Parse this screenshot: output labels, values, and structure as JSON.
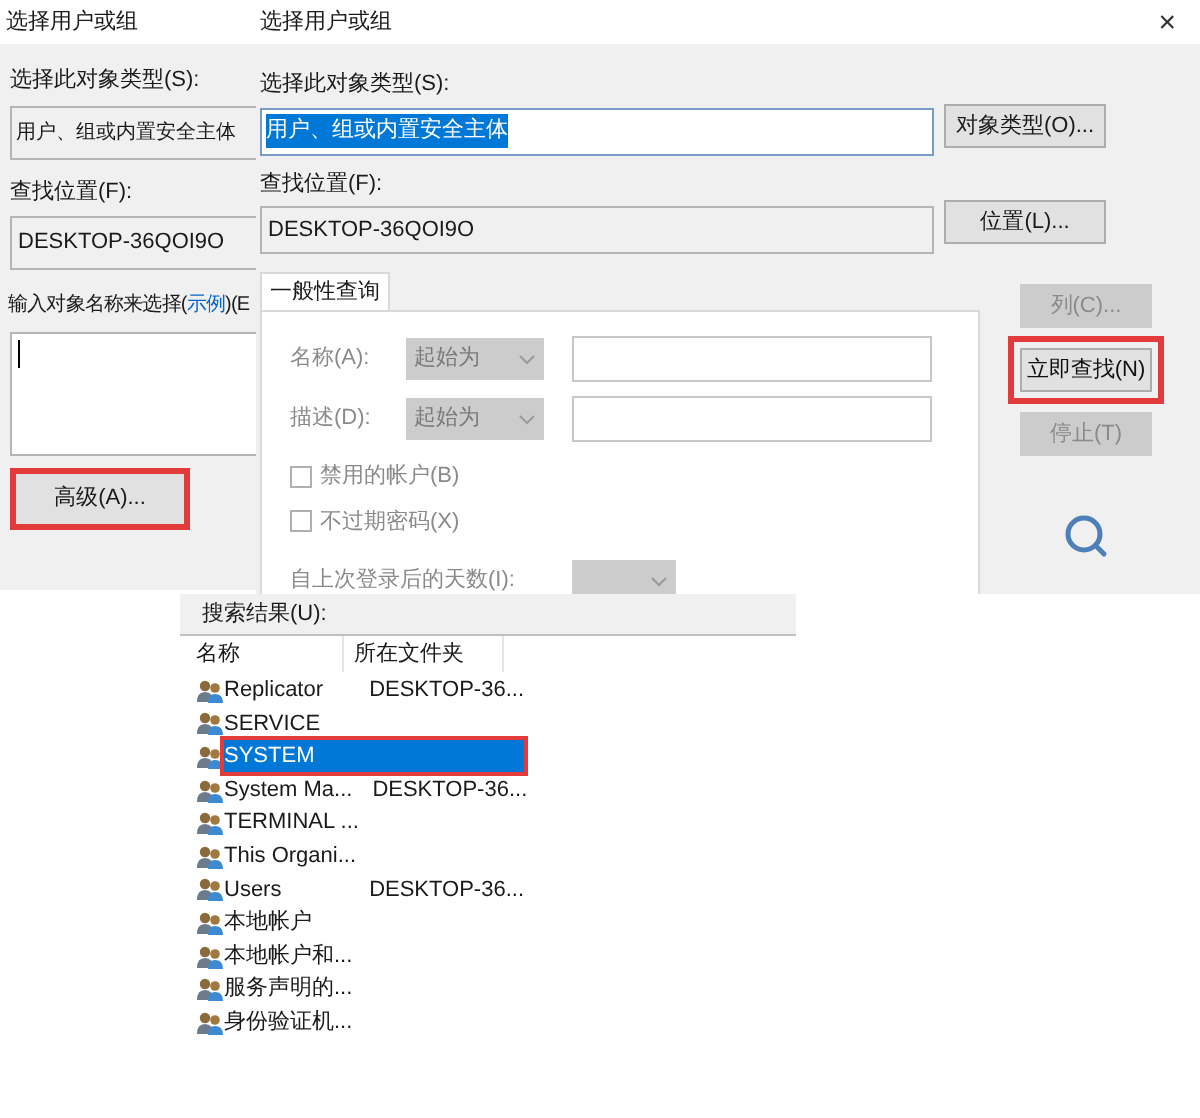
{
  "back_dialog": {
    "title": "选择用户或组",
    "object_type_label": "选择此对象类型(S):",
    "object_type_value": "用户、组或内置安全主体",
    "location_label": "查找位置(F):",
    "location_value": "DESKTOP-36QOI9O",
    "names_label_start": "输入对象名称来选择(",
    "names_label_link": "示例",
    "names_label_end": ")(E",
    "advanced_button": {
      "label": "高级(A)...",
      "highlighted": true
    }
  },
  "dialog": {
    "title": "选择用户或组",
    "close": "×",
    "object_type_label": "选择此对象类型(S):",
    "object_type_value": {
      "text": "用户、组或内置安全主体",
      "selected": true
    },
    "object_types_button": "对象类型(O)...",
    "location_label": "查找位置(F):",
    "location_value": "DESKTOP-36QOI9O",
    "locations_button": "位置(L)...",
    "tabs": [
      {
        "label": "一般性查询",
        "selected": true
      }
    ],
    "query": {
      "name_label": "名称(A):",
      "name_mode": "起始为",
      "description_label": "描述(D):",
      "description_mode": "起始为",
      "checkboxes": [
        {
          "label": "禁用的帐户(B)",
          "checked": false
        },
        {
          "label": "不过期密码(X)",
          "checked": false
        }
      ],
      "days_label": "自上次登录后的天数(I):"
    },
    "side_buttons": [
      {
        "label": "列(C)...",
        "disabled": true,
        "highlighted": false
      },
      {
        "label": "立即查找(N)",
        "disabled": false,
        "highlighted": true
      },
      {
        "label": "停止(T)",
        "disabled": true,
        "highlighted": false
      }
    ]
  },
  "results": {
    "label": "搜索结果(U):",
    "columns": [
      "名称",
      "所在文件夹"
    ],
    "rows": [
      {
        "name": "Replicator",
        "folder": "DESKTOP-36...",
        "selected": false,
        "highlighted": false
      },
      {
        "name": "SERVICE",
        "selected": false,
        "highlighted": false
      },
      {
        "name": "SYSTEM",
        "selected": true,
        "highlighted": true
      },
      {
        "name": "System Ma...",
        "folder": "DESKTOP-36...",
        "selected": false,
        "highlighted": false
      },
      {
        "name": "TERMINAL ...",
        "selected": false,
        "highlighted": false
      },
      {
        "name": "This Organi...",
        "selected": false,
        "highlighted": false
      },
      {
        "name": "Users",
        "folder": "DESKTOP-36...",
        "selected": false,
        "highlighted": false
      },
      {
        "name": "本地帐户",
        "selected": false,
        "highlighted": false
      },
      {
        "name": "本地帐户和...",
        "selected": false,
        "highlighted": false
      },
      {
        "name": "服务声明的...",
        "selected": false,
        "highlighted": false
      },
      {
        "name": "身份验证机...",
        "selected": false,
        "highlighted": false
      }
    ]
  }
}
